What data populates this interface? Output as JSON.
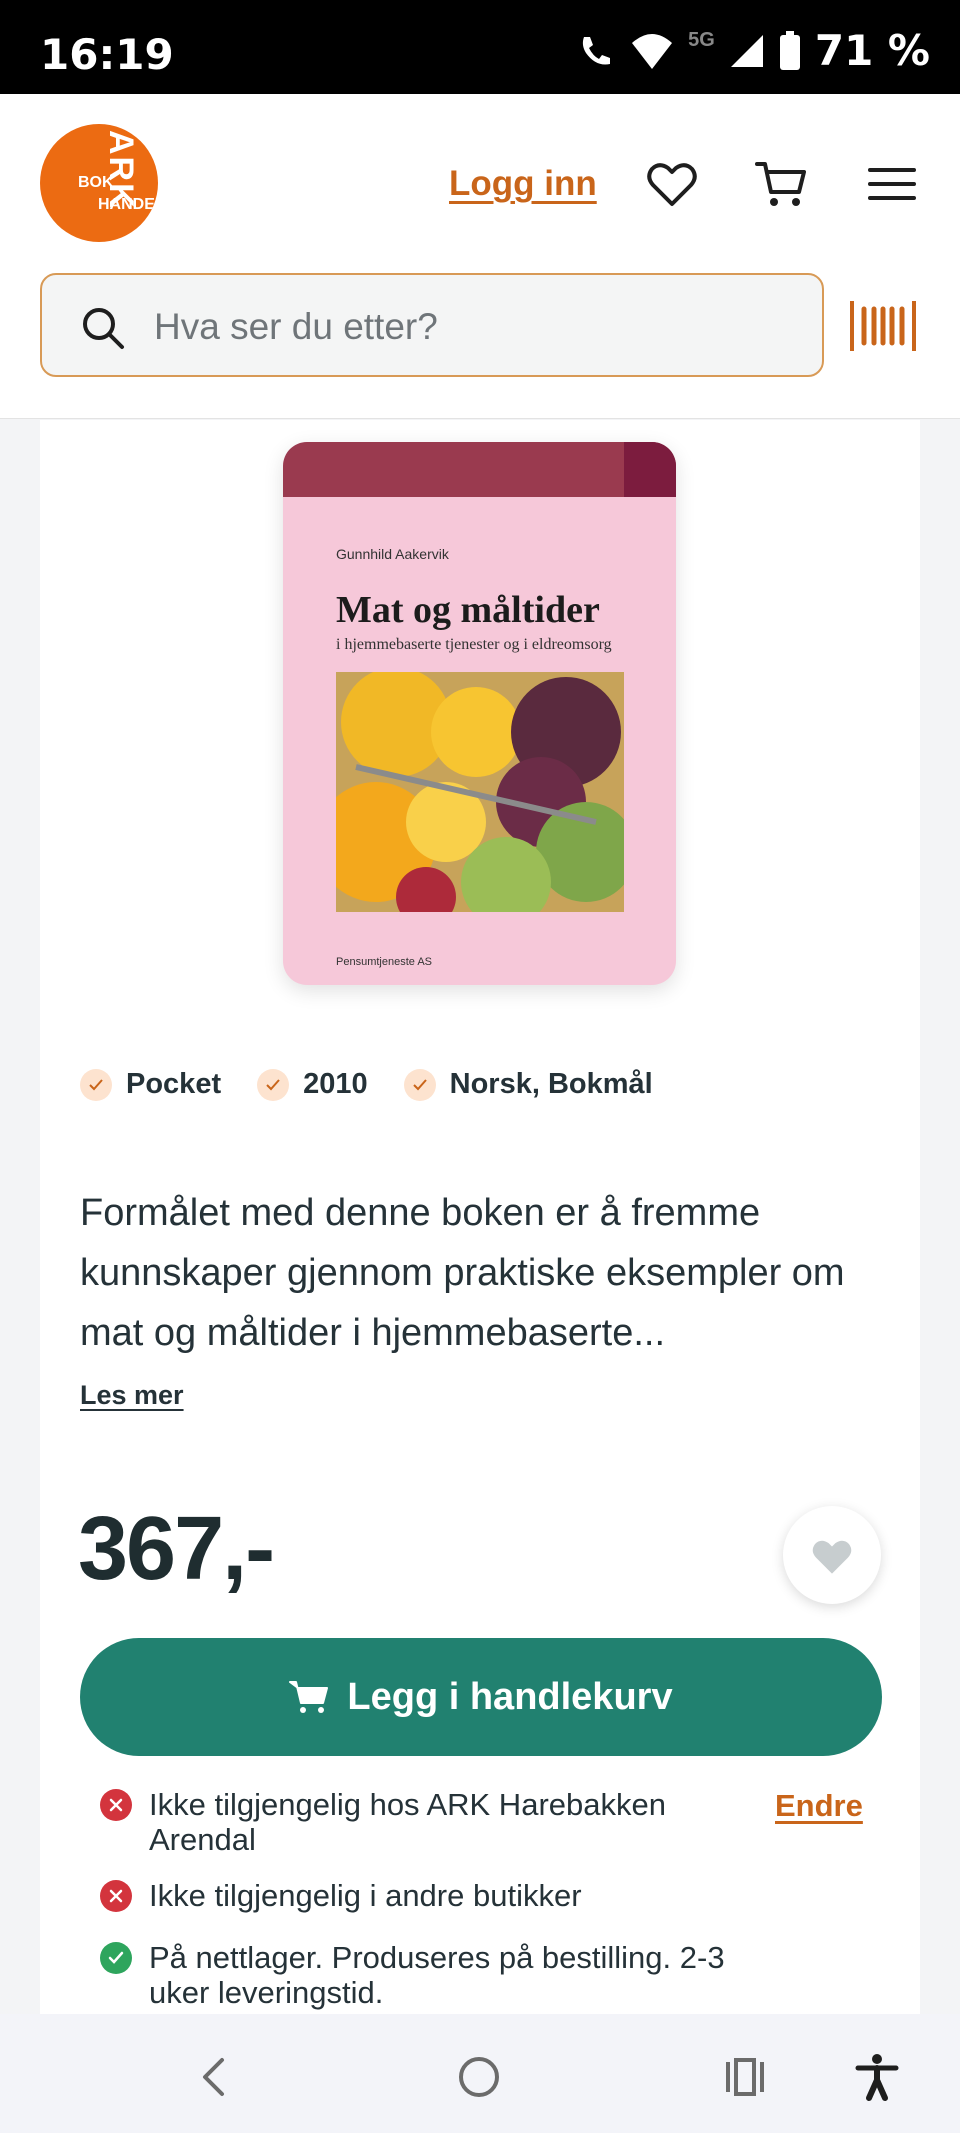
{
  "status_bar": {
    "time": "16:19",
    "network": "5G",
    "battery": "71 %"
  },
  "header": {
    "logo": {
      "top": "ARK",
      "left": "BOK",
      "bottom": "HANDEL"
    },
    "login_label": "Logg inn",
    "icons": [
      "heart-icon",
      "cart-icon",
      "menu-icon"
    ]
  },
  "search": {
    "placeholder": "Hva ser du etter?"
  },
  "product": {
    "cover": {
      "author": "Gunnhild Aakervik",
      "title": "Mat og måltider",
      "subtitle": "i hjemmebaserte tjenester og i eldreomsorg",
      "publisher": "Pensumtjeneste AS"
    },
    "chips": [
      "Pocket",
      "2010",
      "Norsk, Bokmål"
    ],
    "description": "Formålet med denne boken er å fremme kunnskaper gjennom praktiske eksempler om mat og måltider i hjemmebaserte...",
    "read_more": "Les mer",
    "price": "367,-",
    "add_to_cart": "Legg i handlekurv",
    "availability": [
      {
        "status": "unavailable",
        "text": "Ikke tilgjengelig hos ARK Harebakken Arendal"
      },
      {
        "status": "unavailable",
        "text": "Ikke tilgjengelig i andre butikker"
      },
      {
        "status": "available",
        "text": "På nettlager. Produseres på bestilling. 2-3 uker leveringstid."
      }
    ],
    "change_store": "Endre"
  },
  "colors": {
    "accent": "#c9651a",
    "brand": "#ec6b12",
    "cta": "#218170",
    "error": "#d3343d",
    "success": "#2ea55d"
  }
}
